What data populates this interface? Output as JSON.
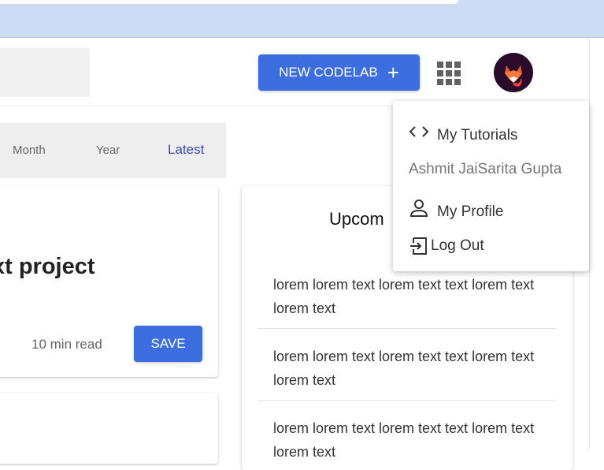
{
  "header": {
    "new_button_label": "NEW CODELAB",
    "plus_symbol": "+"
  },
  "filters": [
    "Month",
    "Year",
    "Latest"
  ],
  "active_filter": "Latest",
  "card": {
    "title": "xt project",
    "read_time": "10 min read",
    "save_label": "SAVE"
  },
  "panel": {
    "title": "Upcom",
    "items": [
      "lorem lorem text lorem text text lorem text lorem text",
      "lorem lorem text lorem text text lorem text lorem text",
      "lorem lorem text lorem text text lorem text lorem text"
    ]
  },
  "user_menu": {
    "my_tutorials": "My Tutorials",
    "user_name": "Ashmit JaiSarita Gupta",
    "my_profile": "My Profile",
    "log_out": "Log Out"
  },
  "colors": {
    "primary": "#3d6ee0",
    "active_filter": "#3e48a6",
    "browser_bar": "#cddcf5",
    "avatar_bg": "#2a0b2b"
  },
  "icons": [
    "plus-icon",
    "apps-grid-icon",
    "fox-avatar-icon",
    "code-icon",
    "person-icon",
    "logout-icon"
  ]
}
